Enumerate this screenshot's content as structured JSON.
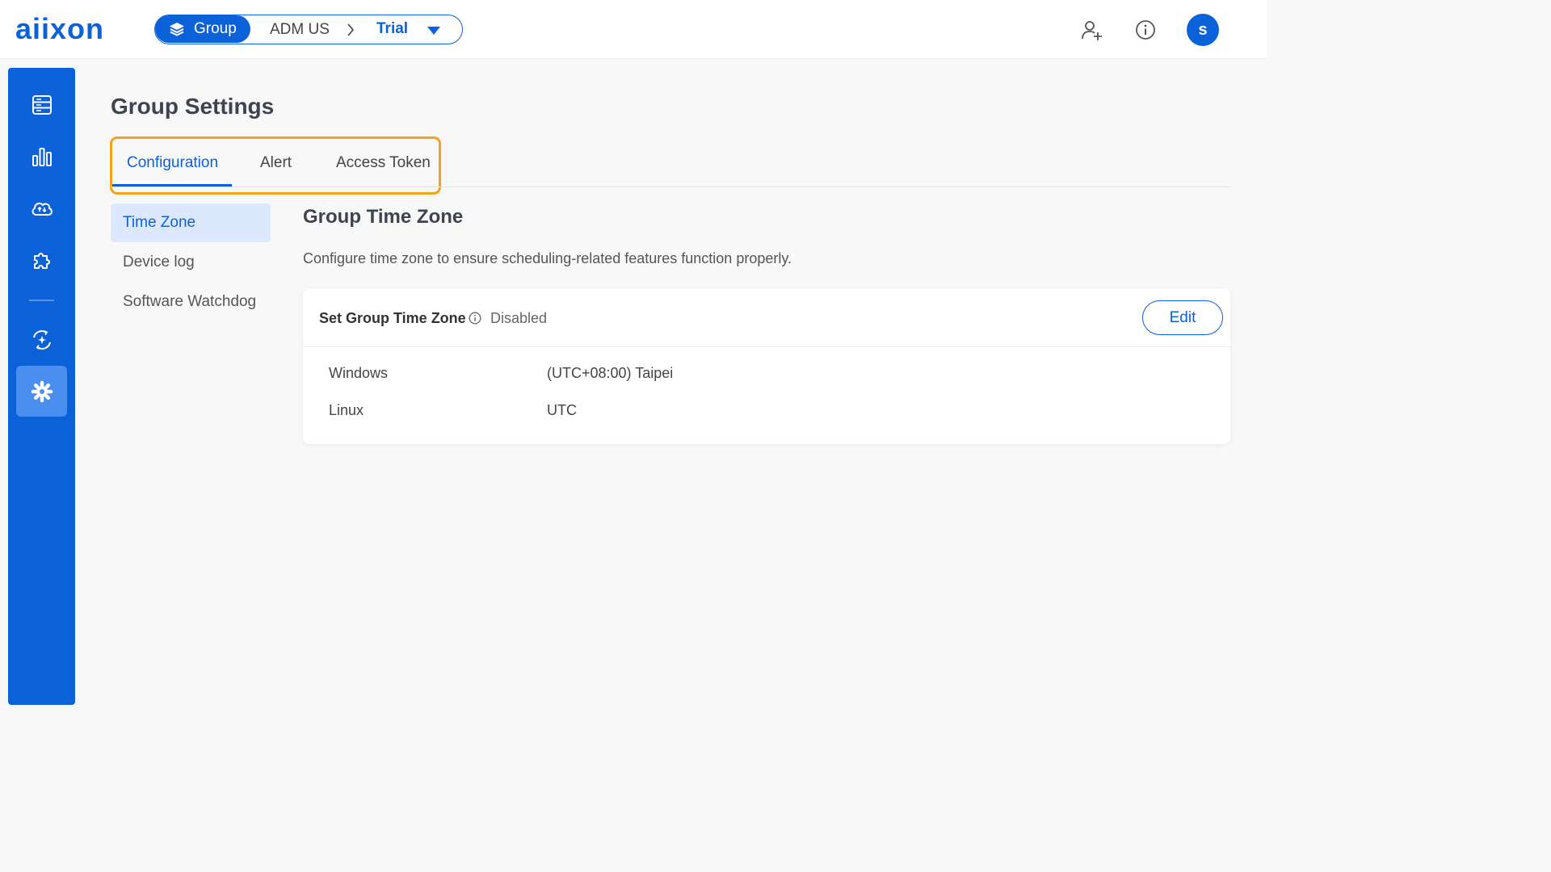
{
  "header": {
    "logo": "aiixon",
    "breadcrumb": {
      "group_label": "Group",
      "org": "ADM US",
      "current": "Trial"
    },
    "avatar_initial": "s",
    "icons": [
      "add-user-icon",
      "info-icon"
    ]
  },
  "sidebar": {
    "items": [
      {
        "icon": "device-list-icon"
      },
      {
        "icon": "dashboard-chart-icon"
      },
      {
        "icon": "cloud-sync-icon"
      },
      {
        "icon": "plugin-icon"
      },
      {
        "icon": "monitor-icon"
      },
      {
        "icon": "settings-gear-icon",
        "active": true
      }
    ]
  },
  "page": {
    "title": "Group Settings"
  },
  "tabs": [
    {
      "label": "Configuration",
      "active": true
    },
    {
      "label": "Alert"
    },
    {
      "label": "Access Token"
    }
  ],
  "sub_nav": [
    {
      "label": "Time Zone",
      "active": true
    },
    {
      "label": "Device log"
    },
    {
      "label": "Software Watchdog"
    }
  ],
  "section": {
    "title": "Group Time Zone",
    "description": "Configure time zone to ensure scheduling-related features function properly."
  },
  "card": {
    "title": "Set Group Time Zone",
    "status": "Disabled",
    "edit_label": "Edit",
    "rows": [
      {
        "label": "Windows",
        "value": "(UTC+08:00) Taipei"
      },
      {
        "label": "Linux",
        "value": "UTC"
      }
    ]
  },
  "colors": {
    "brand": "#0b62d8",
    "highlight": "#f2a41b",
    "active_subnav_bg": "#dbe8fd"
  }
}
